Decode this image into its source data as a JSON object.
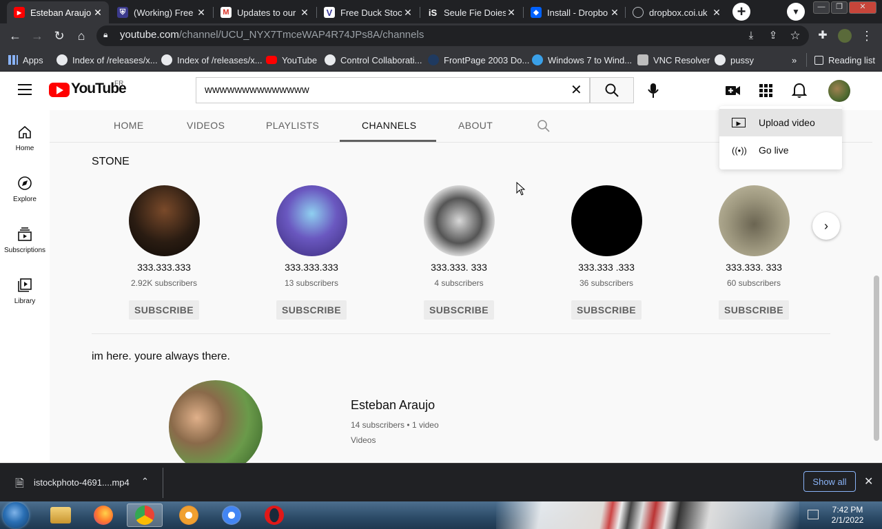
{
  "browser": {
    "tabs": [
      {
        "title": "Esteban Araujo",
        "favicon": "youtube-icon",
        "active": true
      },
      {
        "title": "(Working) Free V",
        "favicon": "purple-shield-icon",
        "active": false
      },
      {
        "title": "Updates to our",
        "favicon": "gmail-icon",
        "active": false
      },
      {
        "title": "Free Duck Stock",
        "favicon": "v-logo-icon",
        "active": false
      },
      {
        "title": "Seule Fie Doies",
        "favicon": "is-logo-icon",
        "active": false
      },
      {
        "title": "Install - Dropbo",
        "favicon": "dropbox-icon",
        "active": false
      },
      {
        "title": "dropbox.coi.uk",
        "favicon": "globe-icon",
        "active": false
      }
    ],
    "new_tab_label": "+",
    "close_label": "✕",
    "url_host": "youtube.com",
    "url_path": "/channel/UCU_NYX7TmceWAP4R74JPs8A/channels",
    "bookmarks": [
      {
        "label": "Apps",
        "icon": "apps-grid-icon"
      },
      {
        "label": "Index of /releases/x...",
        "icon": "globe-icon"
      },
      {
        "label": "Index of /releases/x...",
        "icon": "globe-icon"
      },
      {
        "label": "YouTube",
        "icon": "youtube-icon"
      },
      {
        "label": "Control Collaborati...",
        "icon": "globe-icon"
      },
      {
        "label": "FrontPage 2003 Do...",
        "icon": "frontpage-icon"
      },
      {
        "label": "Windows 7 to Wind...",
        "icon": "edge-icon"
      },
      {
        "label": "VNC Resolver",
        "icon": "vnc-icon"
      },
      {
        "label": "pussy",
        "icon": "globe-icon"
      }
    ],
    "more_bookmarks": "»",
    "reading_list": "Reading list"
  },
  "youtube": {
    "logo_text": "YouTube",
    "country_code": "FR",
    "search_value": "wwwwwwwwwwwwww",
    "nav": [
      {
        "label": "Home",
        "icon": "home-icon"
      },
      {
        "label": "Explore",
        "icon": "compass-icon"
      },
      {
        "label": "Subscriptions",
        "icon": "subscriptions-icon"
      },
      {
        "label": "Library",
        "icon": "library-icon"
      }
    ],
    "channel_tabs": [
      "HOME",
      "VIDEOS",
      "PLAYLISTS",
      "CHANNELS",
      "ABOUT"
    ],
    "selected_tab": "CHANNELS",
    "create_menu": [
      {
        "label": "Upload video",
        "icon": "upload-video-icon"
      },
      {
        "label": "Go live",
        "icon": "go-live-icon"
      }
    ],
    "sections": [
      {
        "title": "STONE",
        "channels": [
          {
            "name": "333.333.333",
            "subscribers": "2.92K subscribers",
            "button": "SUBSCRIBE",
            "avatar_color": "#2a1c12"
          },
          {
            "name": "333.333.333",
            "subscribers": "13 subscribers",
            "button": "SUBSCRIBE",
            "avatar_color": "#5b4aa8"
          },
          {
            "name": "333.333. 333",
            "subscribers": "4 subscribers",
            "button": "SUBSCRIBE",
            "avatar_color": "#8a8a8a"
          },
          {
            "name": "333.333 .333",
            "subscribers": "36 subscribers",
            "button": "SUBSCRIBE",
            "avatar_color": "#000000"
          },
          {
            "name": "333.333. 333",
            "subscribers": "60 subscribers",
            "button": "SUBSCRIBE",
            "avatar_color": "#8c8772"
          }
        ]
      },
      {
        "title": "im here. youre always there.",
        "featured": {
          "name": "Esteban Araujo",
          "subscribers": "14 subscribers",
          "separator": "•",
          "videos": "1 video",
          "link": "Videos",
          "avatar_color": "#6a8a4a"
        }
      }
    ]
  },
  "download_shelf": {
    "filename": "istockphoto-4691....mp4",
    "show_all": "Show all"
  },
  "taskbar": {
    "time": "7:42 PM",
    "date": "2/1/2022",
    "apps": [
      {
        "name": "file-explorer-icon",
        "color": "#e8b64a"
      },
      {
        "name": "firefox-icon",
        "color": "#e8602c"
      },
      {
        "name": "chrome-icon",
        "color": "#4285f4"
      },
      {
        "name": "brave-icon",
        "color": "#f0a030"
      },
      {
        "name": "chrome-icon",
        "color": "#e8b040"
      },
      {
        "name": "opera-icon",
        "color": "#d01010"
      }
    ]
  },
  "colors": {
    "youtube_red": "#ff0000",
    "chrome_dark": "#202124",
    "chrome_toolbar": "#35363a",
    "link_blue": "#8ab4f8"
  }
}
